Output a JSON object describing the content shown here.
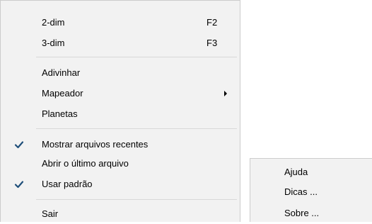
{
  "main_menu": {
    "items": [
      {
        "label": "2-dim",
        "shortcut": "F2"
      },
      {
        "label": "3-dim",
        "shortcut": "F3"
      },
      {
        "label": "Adivinhar"
      },
      {
        "label": "Mapeador",
        "has_submenu": true
      },
      {
        "label": "Planetas"
      },
      {
        "label": "Mostrar arquivos recentes",
        "checked": true
      },
      {
        "label": "Abrir o último arquivo"
      },
      {
        "label": "Usar padrão",
        "checked": true
      },
      {
        "label": "Sair"
      }
    ]
  },
  "help_menu": {
    "items": [
      {
        "label": "Ajuda"
      },
      {
        "label": "Dicas ..."
      },
      {
        "label": "Sobre ..."
      }
    ]
  },
  "icons": {
    "check": "checkmark-icon",
    "submenu_arrow": "submenu-arrow-icon"
  },
  "colors": {
    "menu_background": "#f2f2f2",
    "menu_border": "#cccccc",
    "separator": "#d8d8d8",
    "checkmark": "#1f4f7a"
  }
}
